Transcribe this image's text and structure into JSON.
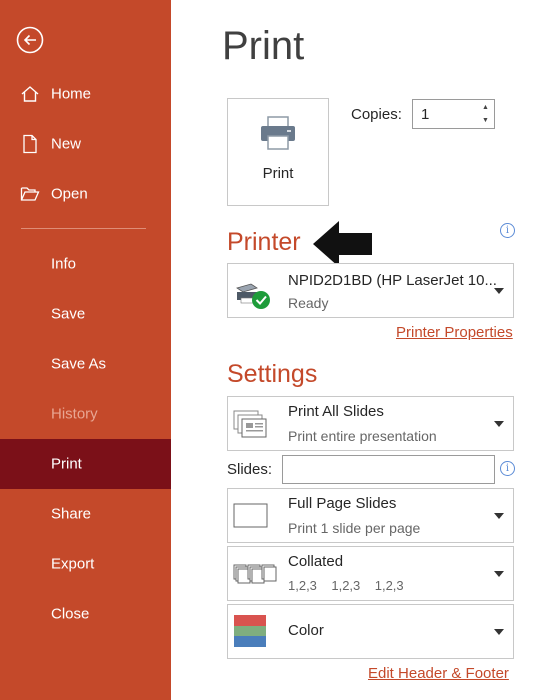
{
  "nav": {
    "items": [
      {
        "label": "Home"
      },
      {
        "label": "New"
      },
      {
        "label": "Open"
      },
      {
        "label": "Info"
      },
      {
        "label": "Save"
      },
      {
        "label": "Save As"
      },
      {
        "label": "History"
      },
      {
        "label": "Print"
      },
      {
        "label": "Share"
      },
      {
        "label": "Export"
      },
      {
        "label": "Close"
      }
    ],
    "active": "Print",
    "disabled": [
      "History"
    ]
  },
  "page": {
    "title": "Print"
  },
  "print_button": {
    "label": "Print"
  },
  "copies": {
    "label": "Copies:",
    "value": "1"
  },
  "printer": {
    "section_title": "Printer",
    "name": "NPID2D1BD (HP LaserJet 10...",
    "status": "Ready",
    "properties_link": "Printer Properties"
  },
  "settings": {
    "section_title": "Settings",
    "slides_label": "Slides:",
    "slides_value": "",
    "print_range": {
      "title": "Print All Slides",
      "subtitle": "Print entire presentation"
    },
    "layout": {
      "title": "Full Page Slides",
      "subtitle": "Print 1 slide per page"
    },
    "collation": {
      "title": "Collated",
      "subtitle": "1,2,3    1,2,3    1,2,3"
    },
    "color": {
      "title": "Color"
    },
    "header_footer_link": "Edit Header & Footer"
  },
  "colors": {
    "accent": "#c4492a",
    "sidebar_active": "#7b1018",
    "info_blue": "#5b8bd6",
    "ready_green": "#1e9c3a"
  }
}
